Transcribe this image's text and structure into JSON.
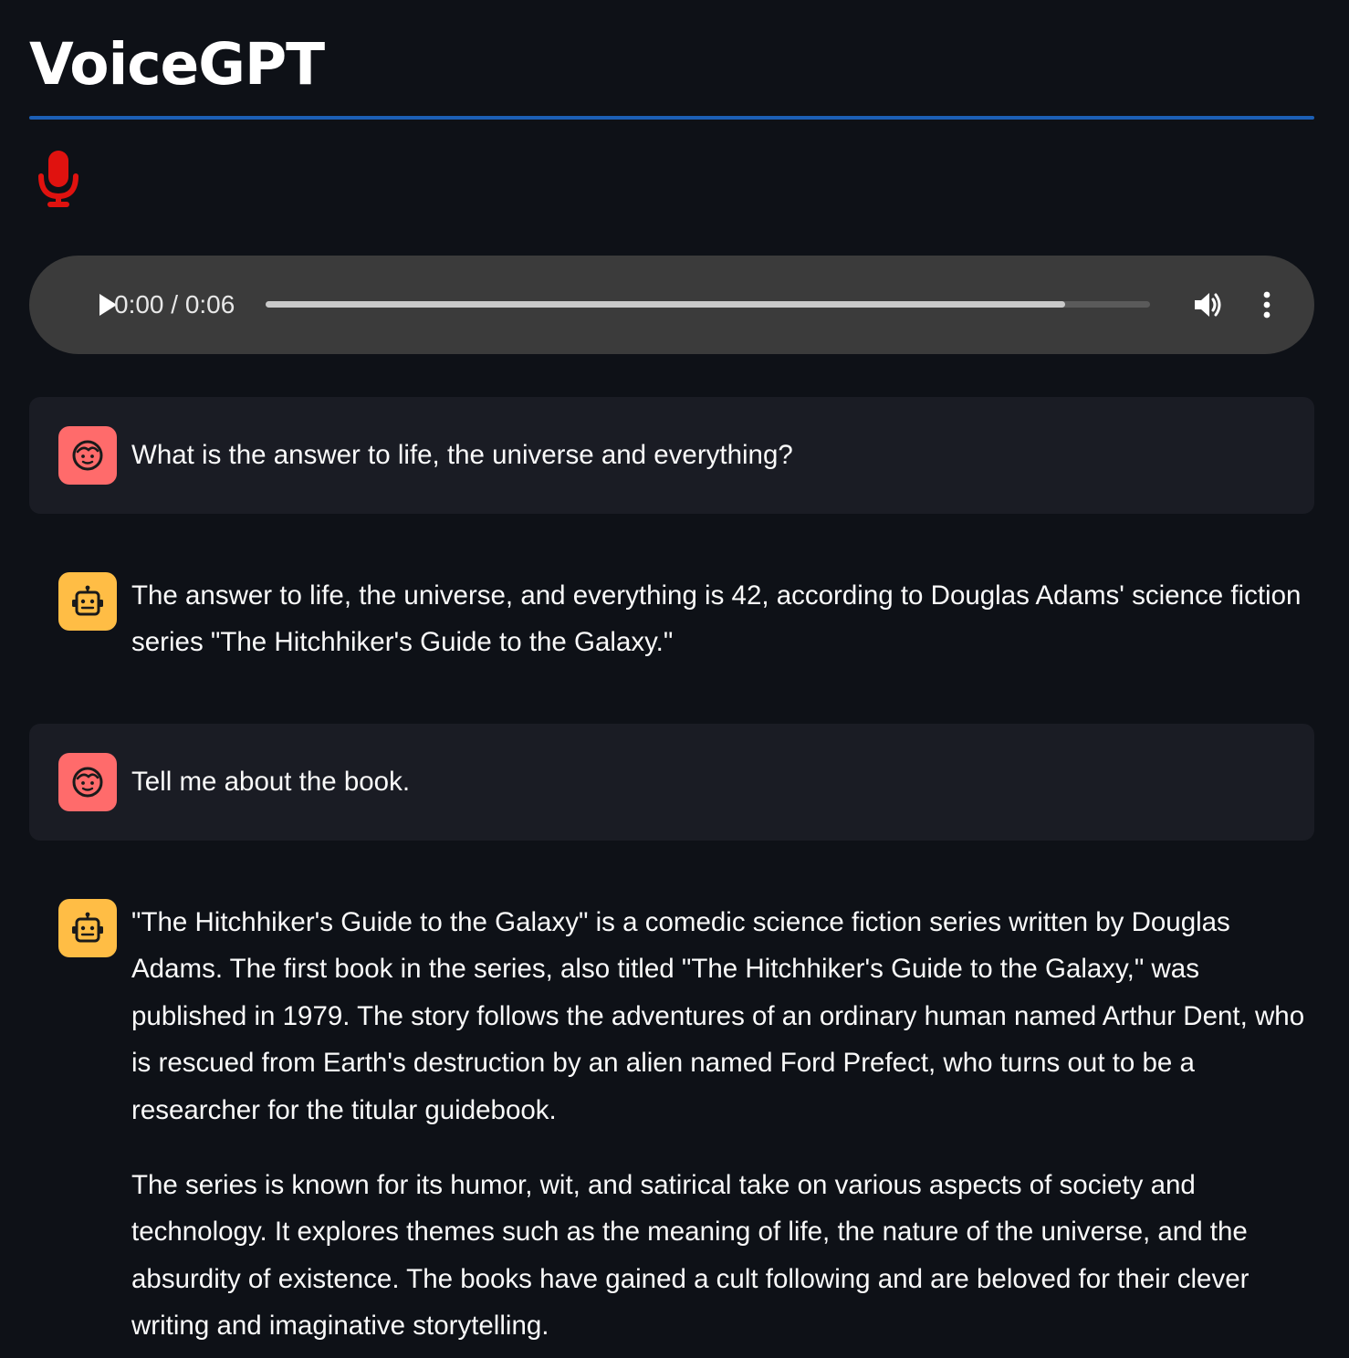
{
  "app": {
    "title": "VoiceGPT"
  },
  "recorder": {
    "icon": "microphone-icon",
    "color": "#e0120f"
  },
  "audio_player": {
    "time_display": "0:00 / 0:06",
    "buffered_fraction": 0.904,
    "play_icon": "play-icon",
    "volume_icon": "volume-icon",
    "more_icon": "more-vertical-icon"
  },
  "messages": [
    {
      "role": "user",
      "avatar_icon": "user-face-icon",
      "paragraphs": [
        "What is the answer to life, the universe and everything?"
      ]
    },
    {
      "role": "assistant",
      "avatar_icon": "robot-icon",
      "paragraphs": [
        "The answer to life, the universe, and everything is 42, according to Douglas Adams' science fiction series \"The Hitchhiker's Guide to the Galaxy.\""
      ]
    },
    {
      "role": "user",
      "avatar_icon": "user-face-icon",
      "paragraphs": [
        "Tell me about the book."
      ]
    },
    {
      "role": "assistant",
      "avatar_icon": "robot-icon",
      "paragraphs": [
        "\"The Hitchhiker's Guide to the Galaxy\" is a comedic science fiction series written by Douglas Adams. The first book in the series, also titled \"The Hitchhiker's Guide to the Galaxy,\" was published in 1979. The story follows the adventures of an ordinary human named Arthur Dent, who is rescued from Earth's destruction by an alien named Ford Prefect, who turns out to be a researcher for the titular guidebook.",
        "The series is known for its humor, wit, and satirical take on various aspects of society and technology. It explores themes such as the meaning of life, the nature of the universe, and the absurdity of existence. The books have gained a cult following and are beloved for their clever writing and imaginative storytelling."
      ]
    }
  ],
  "colors": {
    "background": "#0e1117",
    "accent_divider": "#1c5fb5",
    "user_message_bg": "#1a1c24",
    "user_avatar": "#ff6b6b",
    "assistant_avatar": "#ffbd45",
    "player_bg": "#3b3b3b"
  }
}
